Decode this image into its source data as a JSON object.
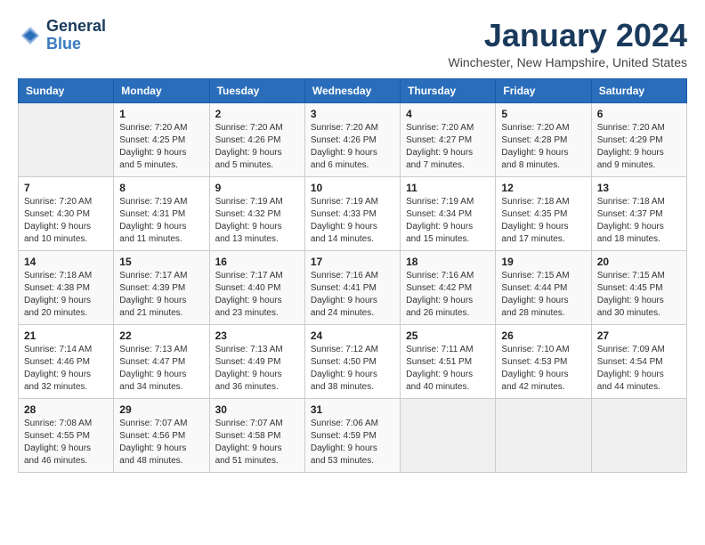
{
  "logo": {
    "text_general": "General",
    "text_blue": "Blue"
  },
  "title": "January 2024",
  "subtitle": "Winchester, New Hampshire, United States",
  "days_of_week": [
    "Sunday",
    "Monday",
    "Tuesday",
    "Wednesday",
    "Thursday",
    "Friday",
    "Saturday"
  ],
  "weeks": [
    [
      {
        "day": "",
        "info": ""
      },
      {
        "day": "1",
        "info": "Sunrise: 7:20 AM\nSunset: 4:25 PM\nDaylight: 9 hours\nand 5 minutes."
      },
      {
        "day": "2",
        "info": "Sunrise: 7:20 AM\nSunset: 4:26 PM\nDaylight: 9 hours\nand 5 minutes."
      },
      {
        "day": "3",
        "info": "Sunrise: 7:20 AM\nSunset: 4:26 PM\nDaylight: 9 hours\nand 6 minutes."
      },
      {
        "day": "4",
        "info": "Sunrise: 7:20 AM\nSunset: 4:27 PM\nDaylight: 9 hours\nand 7 minutes."
      },
      {
        "day": "5",
        "info": "Sunrise: 7:20 AM\nSunset: 4:28 PM\nDaylight: 9 hours\nand 8 minutes."
      },
      {
        "day": "6",
        "info": "Sunrise: 7:20 AM\nSunset: 4:29 PM\nDaylight: 9 hours\nand 9 minutes."
      }
    ],
    [
      {
        "day": "7",
        "info": "Sunrise: 7:20 AM\nSunset: 4:30 PM\nDaylight: 9 hours\nand 10 minutes."
      },
      {
        "day": "8",
        "info": "Sunrise: 7:19 AM\nSunset: 4:31 PM\nDaylight: 9 hours\nand 11 minutes."
      },
      {
        "day": "9",
        "info": "Sunrise: 7:19 AM\nSunset: 4:32 PM\nDaylight: 9 hours\nand 13 minutes."
      },
      {
        "day": "10",
        "info": "Sunrise: 7:19 AM\nSunset: 4:33 PM\nDaylight: 9 hours\nand 14 minutes."
      },
      {
        "day": "11",
        "info": "Sunrise: 7:19 AM\nSunset: 4:34 PM\nDaylight: 9 hours\nand 15 minutes."
      },
      {
        "day": "12",
        "info": "Sunrise: 7:18 AM\nSunset: 4:35 PM\nDaylight: 9 hours\nand 17 minutes."
      },
      {
        "day": "13",
        "info": "Sunrise: 7:18 AM\nSunset: 4:37 PM\nDaylight: 9 hours\nand 18 minutes."
      }
    ],
    [
      {
        "day": "14",
        "info": "Sunrise: 7:18 AM\nSunset: 4:38 PM\nDaylight: 9 hours\nand 20 minutes."
      },
      {
        "day": "15",
        "info": "Sunrise: 7:17 AM\nSunset: 4:39 PM\nDaylight: 9 hours\nand 21 minutes."
      },
      {
        "day": "16",
        "info": "Sunrise: 7:17 AM\nSunset: 4:40 PM\nDaylight: 9 hours\nand 23 minutes."
      },
      {
        "day": "17",
        "info": "Sunrise: 7:16 AM\nSunset: 4:41 PM\nDaylight: 9 hours\nand 24 minutes."
      },
      {
        "day": "18",
        "info": "Sunrise: 7:16 AM\nSunset: 4:42 PM\nDaylight: 9 hours\nand 26 minutes."
      },
      {
        "day": "19",
        "info": "Sunrise: 7:15 AM\nSunset: 4:44 PM\nDaylight: 9 hours\nand 28 minutes."
      },
      {
        "day": "20",
        "info": "Sunrise: 7:15 AM\nSunset: 4:45 PM\nDaylight: 9 hours\nand 30 minutes."
      }
    ],
    [
      {
        "day": "21",
        "info": "Sunrise: 7:14 AM\nSunset: 4:46 PM\nDaylight: 9 hours\nand 32 minutes."
      },
      {
        "day": "22",
        "info": "Sunrise: 7:13 AM\nSunset: 4:47 PM\nDaylight: 9 hours\nand 34 minutes."
      },
      {
        "day": "23",
        "info": "Sunrise: 7:13 AM\nSunset: 4:49 PM\nDaylight: 9 hours\nand 36 minutes."
      },
      {
        "day": "24",
        "info": "Sunrise: 7:12 AM\nSunset: 4:50 PM\nDaylight: 9 hours\nand 38 minutes."
      },
      {
        "day": "25",
        "info": "Sunrise: 7:11 AM\nSunset: 4:51 PM\nDaylight: 9 hours\nand 40 minutes."
      },
      {
        "day": "26",
        "info": "Sunrise: 7:10 AM\nSunset: 4:53 PM\nDaylight: 9 hours\nand 42 minutes."
      },
      {
        "day": "27",
        "info": "Sunrise: 7:09 AM\nSunset: 4:54 PM\nDaylight: 9 hours\nand 44 minutes."
      }
    ],
    [
      {
        "day": "28",
        "info": "Sunrise: 7:08 AM\nSunset: 4:55 PM\nDaylight: 9 hours\nand 46 minutes."
      },
      {
        "day": "29",
        "info": "Sunrise: 7:07 AM\nSunset: 4:56 PM\nDaylight: 9 hours\nand 48 minutes."
      },
      {
        "day": "30",
        "info": "Sunrise: 7:07 AM\nSunset: 4:58 PM\nDaylight: 9 hours\nand 51 minutes."
      },
      {
        "day": "31",
        "info": "Sunrise: 7:06 AM\nSunset: 4:59 PM\nDaylight: 9 hours\nand 53 minutes."
      },
      {
        "day": "",
        "info": ""
      },
      {
        "day": "",
        "info": ""
      },
      {
        "day": "",
        "info": ""
      }
    ]
  ]
}
